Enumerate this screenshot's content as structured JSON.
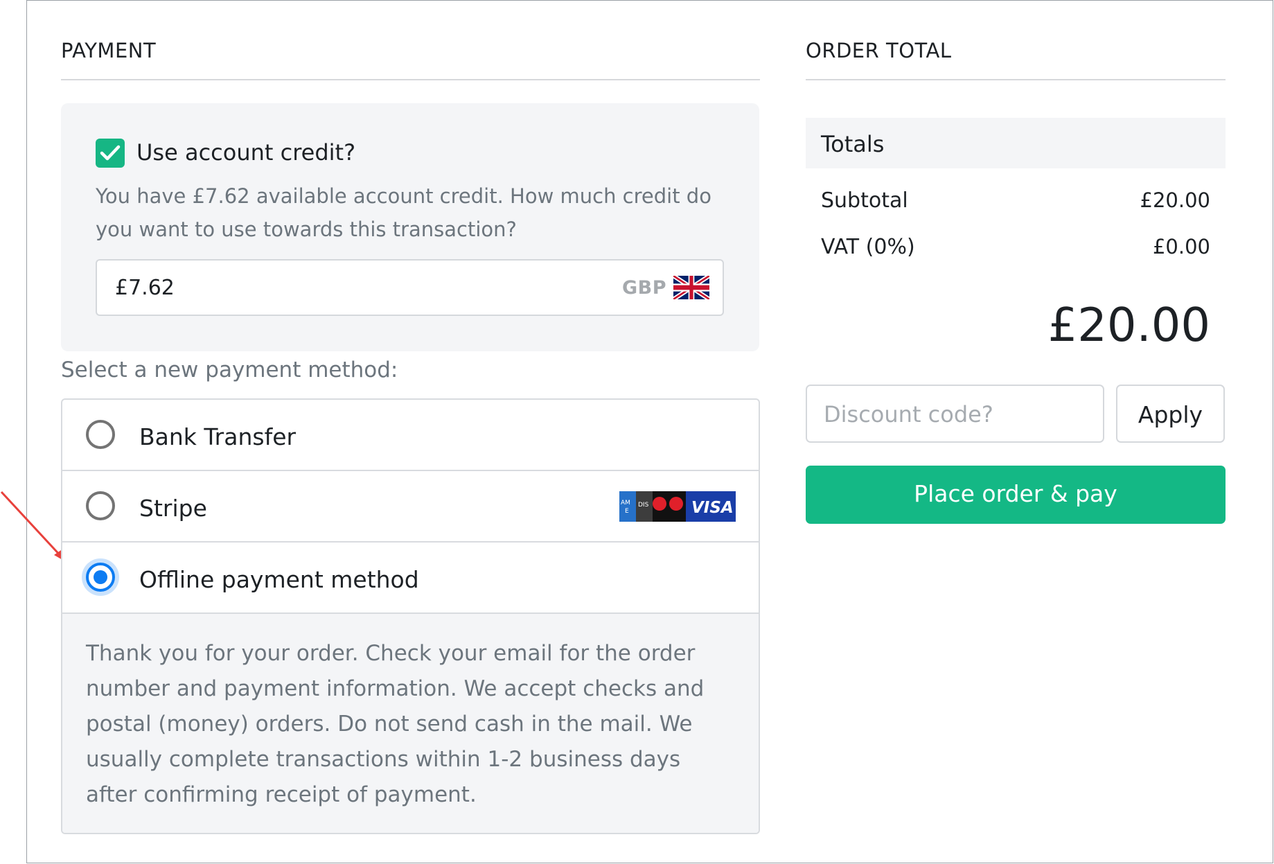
{
  "payment": {
    "title": "PAYMENT",
    "credit": {
      "label": "Use account credit?",
      "checked": true,
      "help": "You have £7.62 available account credit. How much credit do you want to use towards this transaction?",
      "amount": "£7.62",
      "currency": "GBP",
      "flag_icon": "uk-flag-icon"
    },
    "prompt": "Select a new payment method:",
    "methods": [
      {
        "label": "Bank Transfer",
        "selected": false
      },
      {
        "label": "Stripe",
        "selected": false,
        "card_logos": [
          "AMEX",
          "DISCOVER",
          "MAESTRO",
          "MASTERCARD",
          "VISA"
        ]
      },
      {
        "label": "Offline payment method",
        "selected": true
      }
    ],
    "offline_info": "Thank you for your order. Check your email for the order number and payment information. We accept checks and postal (money) orders. Do not send cash in the mail. We usually complete transactions within 1-2 business days after confirming receipt of payment."
  },
  "order_total": {
    "title": "ORDER TOTAL",
    "totals_title": "Totals",
    "subtotal_label": "Subtotal",
    "subtotal_value": "£20.00",
    "vat_label": "VAT (0%)",
    "vat_value": "£0.00",
    "grand_total": "£20.00",
    "discount_placeholder": "Discount code?",
    "apply_label": "Apply",
    "pay_label": "Place order & pay"
  },
  "colors": {
    "accent_green": "#14b885",
    "radio_selected": "#0d7cf2",
    "annotation_arrow": "#e8413c"
  },
  "annotation": {
    "icon": "red-arrow-icon"
  }
}
